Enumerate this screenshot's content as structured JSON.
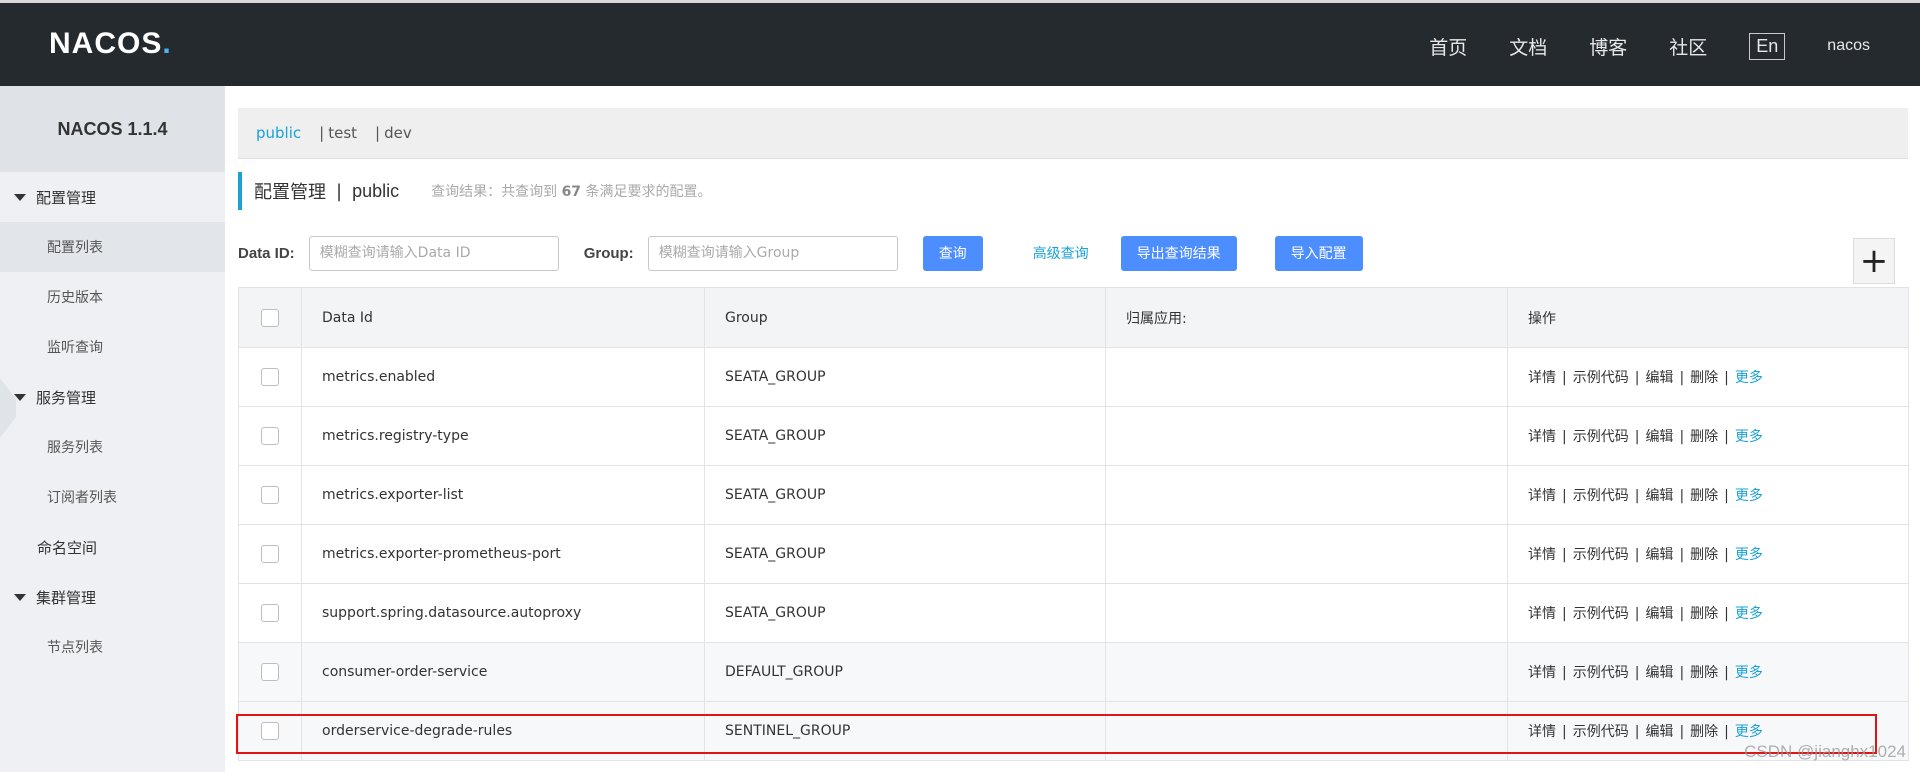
{
  "header": {
    "logo": "NACOS",
    "logo_dot": ".",
    "nav": [
      "首页",
      "文档",
      "博客",
      "社区"
    ],
    "lang": "En",
    "user": "nacos"
  },
  "sidebar": {
    "title": "NACOS 1.1.4",
    "groups": [
      {
        "label": "配置管理",
        "items": [
          "配置列表",
          "历史版本",
          "监听查询"
        ]
      },
      {
        "label": "服务管理",
        "items": [
          "服务列表",
          "订阅者列表"
        ]
      }
    ],
    "namespace": "命名空间",
    "cluster": {
      "label": "集群管理",
      "items": [
        "节点列表"
      ]
    }
  },
  "namespaces": {
    "active": "public",
    "others": [
      "test",
      "dev"
    ],
    "separator": "|"
  },
  "page": {
    "title": "配置管理",
    "separator": "|",
    "namespace": "public",
    "result_prefix": "查询结果：共查询到",
    "result_count": "67",
    "result_suffix": "条满足要求的配置。"
  },
  "search": {
    "dataid_label": "Data ID:",
    "dataid_placeholder": "模糊查询请输入Data ID",
    "group_label": "Group:",
    "group_placeholder": "模糊查询请输入Group",
    "query_btn": "查询",
    "advanced": "高级查询",
    "export_btn": "导出查询结果",
    "import_btn": "导入配置",
    "add_btn": "+"
  },
  "table": {
    "headers": [
      "Data Id",
      "Group",
      "归属应用:",
      "操作"
    ],
    "ops": [
      "详情",
      "示例代码",
      "编辑",
      "删除",
      "更多"
    ],
    "op_separator": "|",
    "rows": [
      {
        "data_id": "metrics.enabled",
        "group": "SEATA_GROUP",
        "app": ""
      },
      {
        "data_id": "metrics.registry-type",
        "group": "SEATA_GROUP",
        "app": ""
      },
      {
        "data_id": "metrics.exporter-list",
        "group": "SEATA_GROUP",
        "app": ""
      },
      {
        "data_id": "metrics.exporter-prometheus-port",
        "group": "SEATA_GROUP",
        "app": ""
      },
      {
        "data_id": "support.spring.datasource.autoproxy",
        "group": "SEATA_GROUP",
        "app": ""
      },
      {
        "data_id": "consumer-order-service",
        "group": "DEFAULT_GROUP",
        "app": ""
      },
      {
        "data_id": "orderservice-degrade-rules",
        "group": "SENTINEL_GROUP",
        "app": ""
      }
    ]
  },
  "watermark": "CSDN @jianghx1024",
  "colors": {
    "topbar": "#252a2f",
    "accent": "#1aa1d6",
    "button": "#4c8dff",
    "highlight": "#e01414"
  }
}
